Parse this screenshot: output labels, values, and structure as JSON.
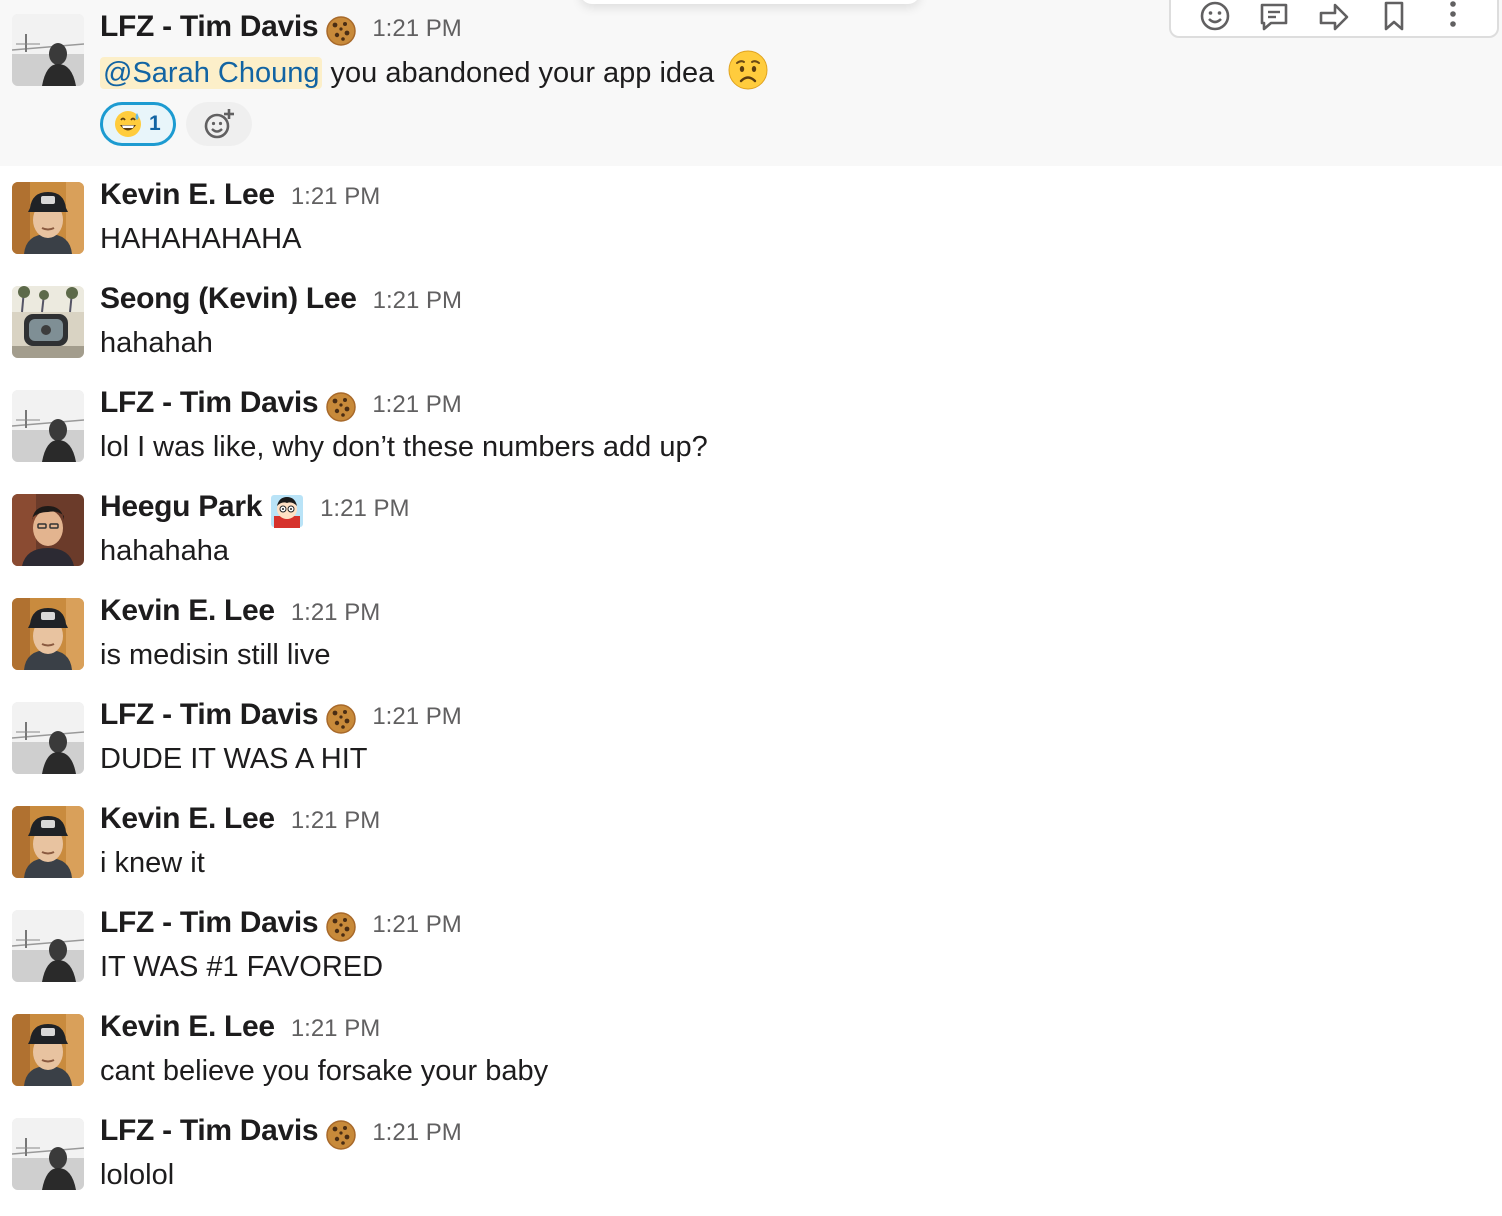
{
  "hover_toolbar": {
    "actions": [
      "add-reaction-icon",
      "reply-in-thread-icon",
      "share-icon",
      "save-icon",
      "more-actions-icon"
    ]
  },
  "messages": [
    {
      "sender": "LFZ - Tim Davis",
      "status_emoji": "cookie",
      "time": "1:21 PM",
      "mention": "@Sarah Choung",
      "text": "you abandoned your app idea",
      "inline_emoji": "worried-face",
      "avatar": "bridge-photo",
      "reactions": [
        {
          "emoji": "grinning-sweat",
          "count": "1"
        }
      ]
    },
    {
      "sender": "Kevin E. Lee",
      "time": "1:21 PM",
      "text": "HAHAHAHAHA",
      "avatar": "cap-photo"
    },
    {
      "sender": "Seong (Kevin) Lee",
      "time": "1:21 PM",
      "text": "hahahah",
      "avatar": "car-mirror-photo"
    },
    {
      "sender": "LFZ - Tim Davis",
      "status_emoji": "cookie",
      "time": "1:21 PM",
      "text": "lol I was like, why don’t these numbers add up?",
      "avatar": "bridge-photo"
    },
    {
      "sender": "Heegu Park",
      "status_emoji": "cartoon-character",
      "time": "1:21 PM",
      "text": "hahahaha",
      "avatar": "portrait-photo"
    },
    {
      "sender": "Kevin E. Lee",
      "time": "1:21 PM",
      "text": "is medisin still live",
      "avatar": "cap-photo"
    },
    {
      "sender": "LFZ - Tim Davis",
      "status_emoji": "cookie",
      "time": "1:21 PM",
      "text": "DUDE IT WAS A HIT",
      "avatar": "bridge-photo"
    },
    {
      "sender": "Kevin E. Lee",
      "time": "1:21 PM",
      "text": "i knew it",
      "avatar": "cap-photo"
    },
    {
      "sender": "LFZ - Tim Davis",
      "status_emoji": "cookie",
      "time": "1:21 PM",
      "text": "IT WAS #1 FAVORED",
      "avatar": "bridge-photo"
    },
    {
      "sender": "Kevin E. Lee",
      "time": "1:21 PM",
      "text": "cant believe you forsake your baby",
      "avatar": "cap-photo"
    },
    {
      "sender": "LFZ - Tim Davis",
      "status_emoji": "cookie",
      "time": "1:21 PM",
      "text": "lololol",
      "avatar": "bridge-photo"
    }
  ]
}
